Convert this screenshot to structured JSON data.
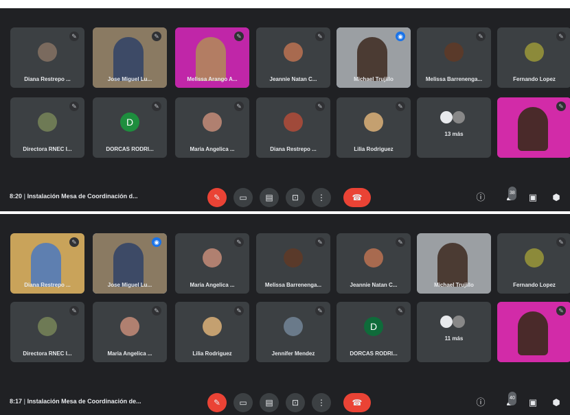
{
  "top": {
    "row1": [
      {
        "name": "Diana Restrepo ...",
        "mic": "✎"
      },
      {
        "name": "Jose Miguel Lu...",
        "mic": "✎"
      },
      {
        "name": "Melissa Arango A...",
        "mic": "✎"
      },
      {
        "name": "Jeannie Natan C...",
        "mic": "✎"
      },
      {
        "name": "Michael Trujillo",
        "mic": "◉"
      },
      {
        "name": "Melissa Barrenenga...",
        "mic": "✎"
      },
      {
        "name": "Fernando Lopez",
        "mic": "✎"
      }
    ],
    "row2": [
      {
        "name": "Directora RNEC I...",
        "mic": "✎"
      },
      {
        "name": "DORCAS RODRI...",
        "mic": "✎",
        "letter": "D"
      },
      {
        "name": "Maria Angelica ...",
        "mic": "✎"
      },
      {
        "name": "Diana Restrepo ...",
        "mic": "✎"
      },
      {
        "name": "Lilia Rodriguez",
        "mic": "✎"
      },
      {
        "name": "13 más",
        "mic": ""
      },
      {
        "name": "",
        "mic": "✎"
      }
    ],
    "time": "8:20",
    "meeting_title": "Instalación Mesa de Coordinación d...",
    "badge": "38"
  },
  "bottom": {
    "row1": [
      {
        "name": "Diana Restrepo ...",
        "mic": "✎"
      },
      {
        "name": "Jose Miguel Lu...",
        "mic": "◉"
      },
      {
        "name": "Maria Angelica ...",
        "mic": "✎"
      },
      {
        "name": "Melissa Barrenenga...",
        "mic": "✎"
      },
      {
        "name": "Jeannie Natan C...",
        "mic": "✎"
      },
      {
        "name": "Michael Trujillo",
        "mic": ""
      },
      {
        "name": "Fernando Lopez",
        "mic": "✎"
      }
    ],
    "row2": [
      {
        "name": "Directora RNEC I...",
        "mic": "✎"
      },
      {
        "name": "Maria Angelica ...",
        "mic": "✎"
      },
      {
        "name": "Lilia Rodriguez",
        "mic": "✎"
      },
      {
        "name": "Jennifer Mendez",
        "mic": "✎"
      },
      {
        "name": "DORCAS RODRI...",
        "mic": "✎",
        "letter": "D"
      },
      {
        "name": "11 más",
        "mic": ""
      },
      {
        "name": "",
        "mic": "✎"
      }
    ],
    "time": "8:17",
    "meeting_title": "Instalación Mesa de Coordinación de...",
    "badge": "40"
  },
  "icons": {
    "mic_off": "mic-off-icon",
    "camera": "camera-icon",
    "captions": "captions-icon",
    "present": "present-icon",
    "more": "more-options-icon",
    "end_call": "end-call-icon",
    "info": "info-icon",
    "people": "people-icon",
    "chat": "chat-icon",
    "activities": "activities-icon"
  },
  "glyphs": {
    "mic_off": "✎",
    "camera": "▭",
    "captions": "▤",
    "present": "⊡",
    "more": "⋮",
    "end_call": "☎",
    "info": "ⓘ",
    "people": "♟",
    "chat": "▣",
    "activities": "⬢"
  },
  "colors": {
    "background": "#202124",
    "tile": "#3c4043",
    "end_call": "#ea4335",
    "highlight": "#8ab4f8"
  }
}
